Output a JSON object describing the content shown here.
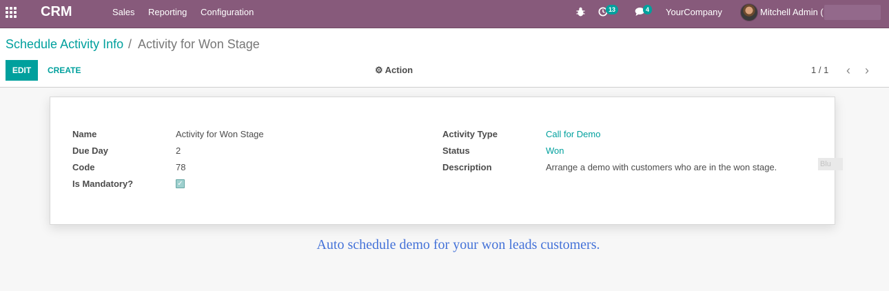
{
  "navbar": {
    "app_name": "CRM",
    "menu": [
      "Sales",
      "Reporting",
      "Configuration"
    ],
    "activity_count": "13",
    "message_count": "4",
    "company": "YourCompany",
    "user": "Mitchell Admin (",
    "icons": [
      "apps-grid-icon",
      "bug-icon",
      "clock-icon",
      "chat-icon"
    ]
  },
  "breadcrumb": {
    "parent": "Schedule Activity Info",
    "separator": "/",
    "current": "Activity for Won Stage"
  },
  "toolbar": {
    "edit_label": "EDIT",
    "create_label": "CREATE",
    "action_label": "Action",
    "pager": "1 / 1",
    "prev_glyph": "‹",
    "next_glyph": "›"
  },
  "form": {
    "name_label": "Name",
    "name_value": "Activity for Won Stage",
    "due_day_label": "Due Day",
    "due_day_value": "2",
    "code_label": "Code",
    "code_value": "78",
    "mandatory_label": "Is Mandatory?",
    "mandatory_checked": true,
    "activity_type_label": "Activity Type",
    "activity_type_value": "Call for Demo",
    "status_label": "Status",
    "status_value": "Won",
    "description_label": "Description",
    "description_value": "Arrange a demo with customers who are in the won stage."
  },
  "side_tag": "Blu",
  "caption": "Auto schedule demo for your won leads customers.",
  "colors": {
    "navbar": "#875a7b",
    "accent": "#00a09d",
    "caption": "#4472d8"
  }
}
